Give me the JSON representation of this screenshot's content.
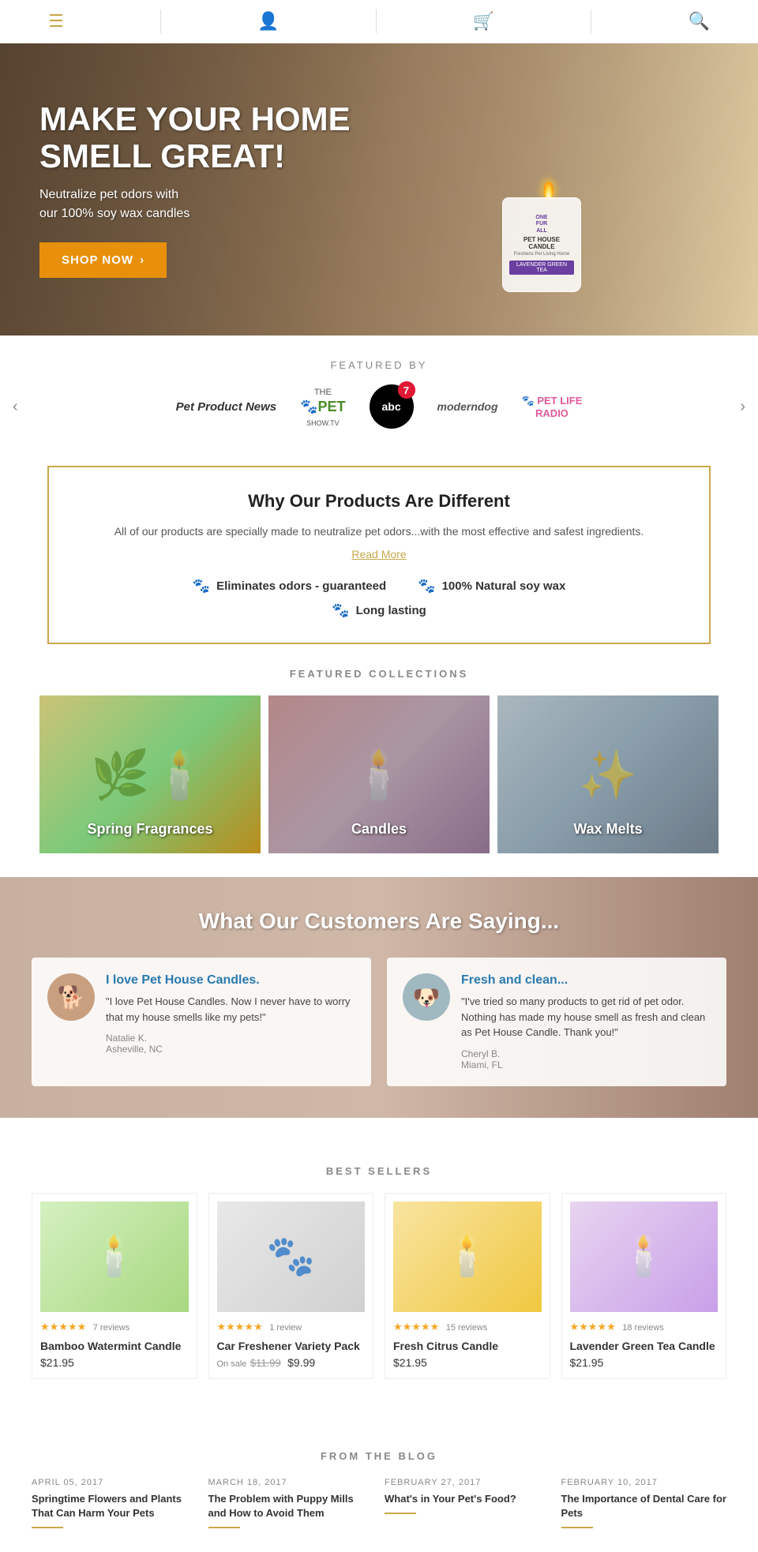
{
  "header": {
    "menu_icon": "☰",
    "account_icon": "👤",
    "cart_icon": "🛒",
    "search_icon": "🔍"
  },
  "hero": {
    "title": "MAKE YOUR HOME SMELL GREAT!",
    "subtitle": "Neutralize pet odors with\nour 100% soy wax candles",
    "cta_label": "SHOP NOW",
    "cta_arrow": "›"
  },
  "featured_by": {
    "label": "FEATURED BY",
    "logos": [
      {
        "name": "Pet Product News",
        "display": "Pet Product News"
      },
      {
        "name": "The Pet Show TV",
        "display": "THE PET\nSHOW.TV"
      },
      {
        "name": "ABC 7",
        "display": "abc"
      },
      {
        "name": "Modern Dog",
        "display": "moderndog"
      },
      {
        "name": "Pet Life Radio",
        "display": "PET LIFE\nRADIO"
      }
    ]
  },
  "why_section": {
    "title": "Why Our Products Are Different",
    "desc": "All of our products are specially made to neutralize pet odors...with the most effective and safest ingredients.",
    "read_more": "Read More",
    "features": [
      {
        "icon": "🐾",
        "text": "Eliminates odors - guaranteed"
      },
      {
        "icon": "🐾",
        "text": "100% Natural soy wax"
      },
      {
        "icon": "🐾",
        "text": "Long lasting"
      }
    ]
  },
  "collections": {
    "section_title": "FEATURED COLLECTIONS",
    "items": [
      {
        "label": "Spring Fragrances",
        "emoji": "🌿"
      },
      {
        "label": "Candles",
        "emoji": "🕯️"
      },
      {
        "label": "Wax Melts",
        "emoji": "✨"
      }
    ]
  },
  "testimonials": {
    "title": "What Our Customers Are Saying...",
    "items": [
      {
        "title": "I love Pet House Candles.",
        "text": "\"I love Pet House Candles. Now I never have to worry that my house smells like my pets!\"",
        "author": "Natalie K.",
        "location": "Asheville, NC",
        "avatar": "🐕"
      },
      {
        "title": "Fresh and clean...",
        "text": "\"I've tried so many products to get rid of pet odor. Nothing has made my house smell as fresh and clean as Pet House Candle. Thank you!\"",
        "author": "Cheryl B.",
        "location": "Miami, FL",
        "avatar": "🐶"
      }
    ]
  },
  "best_sellers": {
    "section_title": "BEST SELLERS",
    "products": [
      {
        "name": "Bamboo Watermint Candle",
        "price": "$21.95",
        "stars": "★★★★★",
        "reviews": "7 reviews",
        "on_sale": false,
        "image_class": "candle-img-1",
        "emoji": "🕯️"
      },
      {
        "name": "Car Freshener Variety Pack",
        "on_sale": true,
        "original_price": "$11.99",
        "sale_price": "$9.99",
        "sale_label": "On sale",
        "stars": "★★★★★",
        "reviews": "1 review",
        "image_class": "candle-img-2",
        "emoji": "🐾"
      },
      {
        "name": "Fresh Citrus Candle",
        "price": "$21.95",
        "stars": "★★★★★",
        "reviews": "15 reviews",
        "on_sale": false,
        "image_class": "candle-img-3",
        "emoji": "🕯️"
      },
      {
        "name": "Lavender Green Tea Candle",
        "price": "$21.95",
        "stars": "★★★★★",
        "reviews": "18 reviews",
        "on_sale": false,
        "image_class": "candle-img-4",
        "emoji": "🕯️"
      }
    ]
  },
  "blog": {
    "section_title": "FROM THE BLOG",
    "posts": [
      {
        "date": "APRIL 05, 2017",
        "title": "Springtime Flowers and Plants That Can Harm Your Pets"
      },
      {
        "date": "MARCH 18, 2017",
        "title": "The Problem with Puppy Mills and How to Avoid Them"
      },
      {
        "date": "FEBRUARY 27, 2017",
        "title": "What's in Your Pet's Food?"
      },
      {
        "date": "FEBRUARY 10, 2017",
        "title": "The Importance of Dental Care for Pets"
      }
    ]
  }
}
